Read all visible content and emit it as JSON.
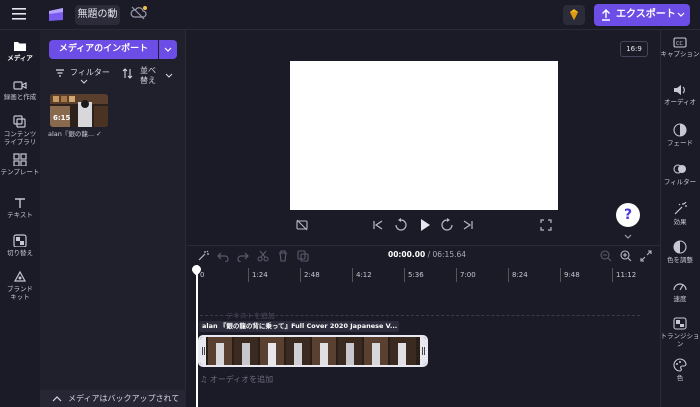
{
  "header": {
    "project_title": "無題の動",
    "export_label": "エクスポート",
    "icons": [
      "hamburger-icon",
      "clipchamp-logo",
      "cloud-off-icon",
      "premium-gem-icon",
      "upload-icon"
    ]
  },
  "left_nav": {
    "items": [
      {
        "label": "メディア",
        "icon": "folder-icon",
        "active": true
      },
      {
        "label": "録画と作成",
        "icon": "camera-icon"
      },
      {
        "label": "コンテンツ ライブラリ",
        "icon": "library-icon"
      },
      {
        "label": "テンプレート",
        "icon": "template-icon"
      },
      {
        "label": "テキスト",
        "icon": "text-icon"
      },
      {
        "label": "切り替え",
        "icon": "transition-icon"
      },
      {
        "label": "ブランド キット",
        "icon": "brand-kit-icon"
      }
    ]
  },
  "media_panel": {
    "import_label": "メディアのインポート",
    "filter_label": "フィルター",
    "sort_label": "並べ替え",
    "media_items": [
      {
        "title": "alan『銀の龍...",
        "duration": "6:15",
        "added": true
      }
    ],
    "backup_notice": "メディアはバックアップされて"
  },
  "preview": {
    "aspect_ratio": "16:9",
    "help_label": "?"
  },
  "timeline": {
    "current_time": "00:00.00",
    "total_time": "/ 06:15.64",
    "ruler_ticks": [
      "0",
      "1:24",
      "2:48",
      "4:12",
      "5:36",
      "7:00",
      "8:24",
      "9:48",
      "11:12"
    ],
    "clip_title": "alan 『銀の龍の背に乗って』Full Cover 2020 Japanese V...",
    "text_track_placeholder": "テキストを追加",
    "audio_track_placeholder": "オーディオを追加"
  },
  "right_panel": {
    "items": [
      {
        "label": "キャプション",
        "icon": "captions-icon"
      },
      {
        "label": "オーディオ",
        "icon": "speaker-icon"
      },
      {
        "label": "フェード",
        "icon": "fade-icon"
      },
      {
        "label": "フィルター",
        "icon": "filter-icon"
      },
      {
        "label": "効果",
        "icon": "effects-icon"
      },
      {
        "label": "色を調整",
        "icon": "color-adjust-icon"
      },
      {
        "label": "速度",
        "icon": "speed-icon"
      },
      {
        "label": "トランジション",
        "icon": "transition-icon"
      },
      {
        "label": "色",
        "icon": "palette-icon"
      }
    ]
  },
  "colors": {
    "accent": "#6c4de5",
    "background": "#1b1b27",
    "panel": "#20202d"
  }
}
